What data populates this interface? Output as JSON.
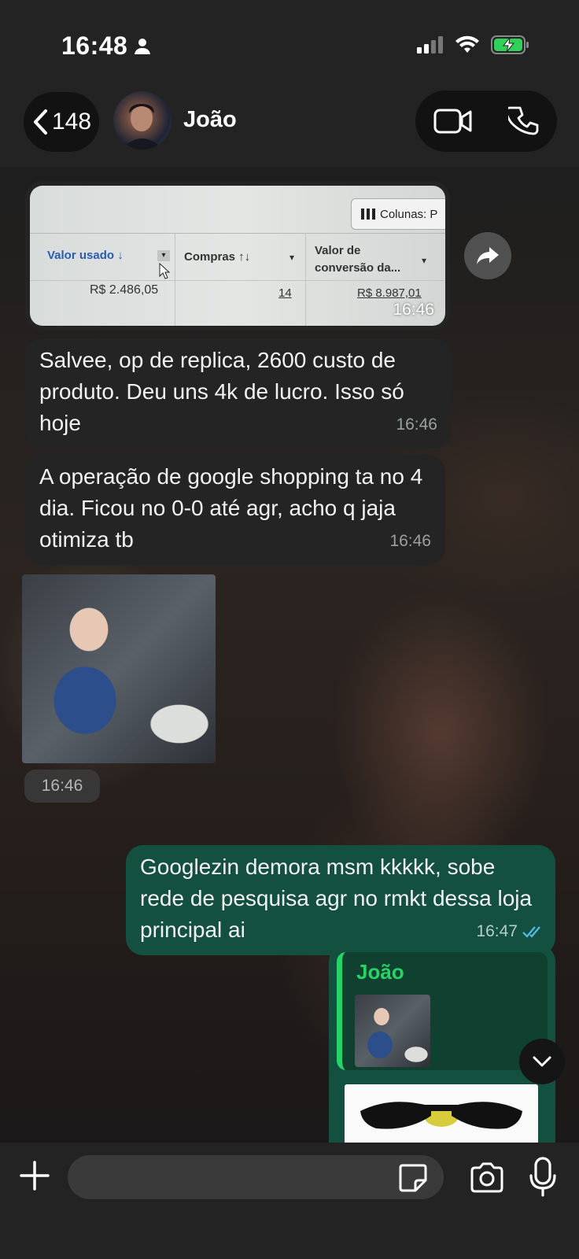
{
  "status_bar": {
    "time": "16:48"
  },
  "header": {
    "back_count": "148",
    "contact_name": "João"
  },
  "messages": [
    {
      "id": "m1",
      "type": "image",
      "sheet": {
        "columns_button": "Colunas: P",
        "col1": "Valor usado ↓",
        "col2": "Compras ↑↓",
        "col3_line1": "Valor de",
        "col3_line2": "conversão da...",
        "val1": "R$ 2.486,05",
        "val2": "14",
        "val3": "R$ 8.987,01"
      },
      "time": "16:46"
    },
    {
      "id": "m2",
      "type": "text",
      "text": "Salvee, op de replica, 2600 custo de produto. Deu uns 4k de lucro. Isso só hoje",
      "time": "16:46"
    },
    {
      "id": "m3",
      "type": "text",
      "text": "A operação de google shopping ta no 4 dia. Ficou no 0-0 até agr, acho q jaja otimiza tb",
      "time": "16:46"
    },
    {
      "id": "m4",
      "type": "image",
      "time": "16:46"
    },
    {
      "id": "m5",
      "type": "text",
      "outgoing": true,
      "text": "Googlezin demora msm kkkkk, sobe rede de pesquisa agr no rmkt dessa loja principal ai",
      "time": "16:47"
    },
    {
      "id": "m6",
      "type": "reply",
      "outgoing": true,
      "quoted_name": "João"
    }
  ],
  "composer": {
    "placeholder": ""
  },
  "colors": {
    "incoming_bubble": "#242424",
    "outgoing_bubble": "#135040",
    "accent_green": "#25d366",
    "read_ticks": "#53bdeb"
  }
}
